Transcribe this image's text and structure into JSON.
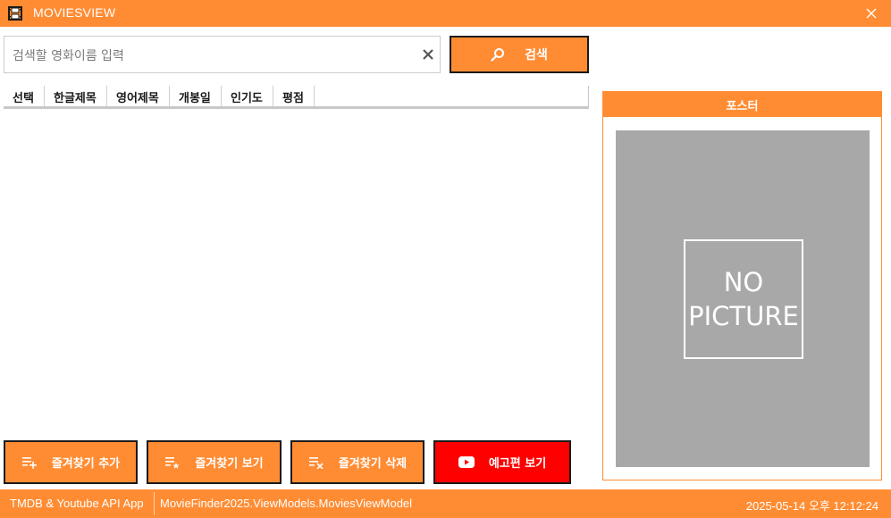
{
  "window": {
    "title": "MOVIESVIEW",
    "icon": "film-icon",
    "close_icon": "close-icon"
  },
  "search": {
    "placeholder": "검색할 영화이름 입력",
    "value": "",
    "clear_icon": "clear-icon",
    "button_label": "검색",
    "button_icon": "search-icon"
  },
  "table": {
    "columns": [
      "선택",
      "한글제목",
      "영어제목",
      "개봉일",
      "인기도",
      "평점"
    ],
    "rows": []
  },
  "actions": {
    "add_favorite": {
      "label": "즐겨찾기 추가",
      "icon": "playlist-add-icon"
    },
    "view_favorite": {
      "label": "즐겨찾기 보기",
      "icon": "playlist-star-icon"
    },
    "delete_favorite": {
      "label": "즐겨찾기 삭제",
      "icon": "playlist-remove-icon"
    },
    "trailer": {
      "label": "예고편 보기",
      "icon": "youtube-icon"
    }
  },
  "poster": {
    "header": "포스터",
    "placeholder_line1": "NO",
    "placeholder_line2": "PICTURE"
  },
  "status": {
    "app": "TMDB & Youtube API App",
    "viewmodel": "MovieFinder2025.ViewModels.MoviesViewModel",
    "datetime": "2025-05-14 오후 12:12:24"
  },
  "colors": {
    "accent": "#FF8C33",
    "trailer": "#FF0000",
    "poster_bg": "#A8A8A8"
  }
}
